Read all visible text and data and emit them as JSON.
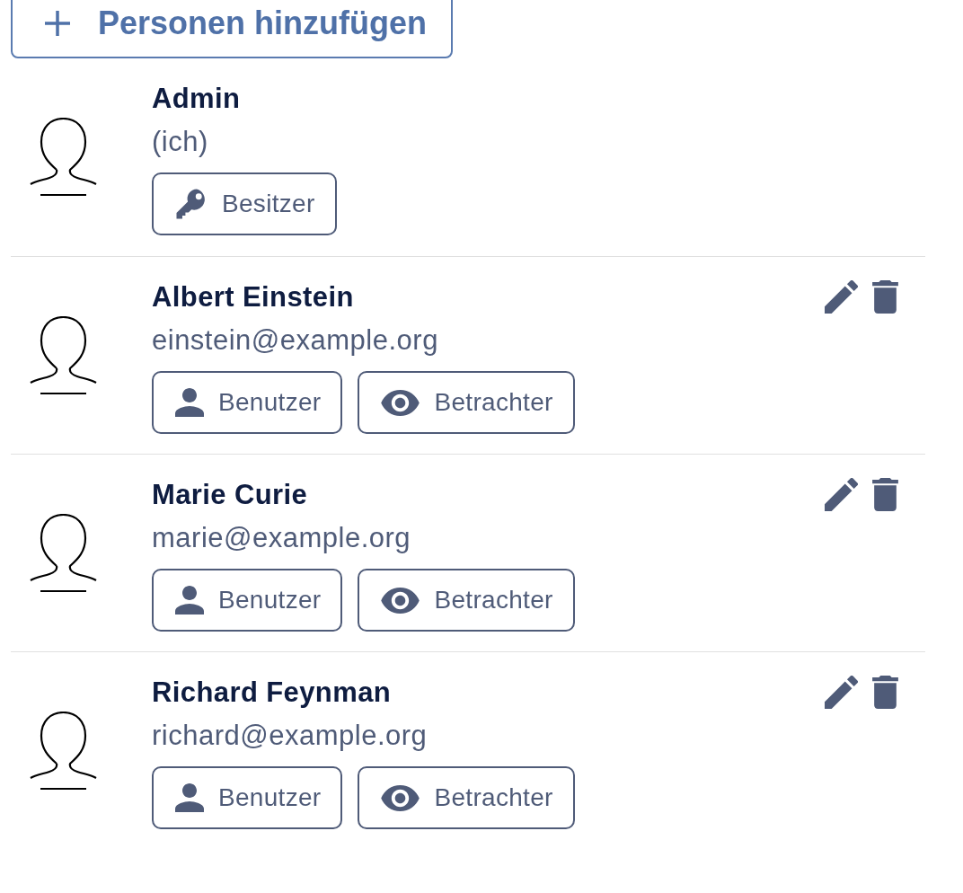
{
  "add_button": {
    "label": "Personen hinzufügen"
  },
  "people": [
    {
      "name": "Admin",
      "subtitle": "(ich)",
      "editable": false,
      "roles": [
        {
          "kind": "owner",
          "label": "Besitzer"
        }
      ]
    },
    {
      "name": "Albert Einstein",
      "subtitle": "einstein@example.org",
      "editable": true,
      "roles": [
        {
          "kind": "user",
          "label": "Benutzer"
        },
        {
          "kind": "viewer",
          "label": "Betrachter"
        }
      ]
    },
    {
      "name": "Marie Curie",
      "subtitle": "marie@example.org",
      "editable": true,
      "roles": [
        {
          "kind": "user",
          "label": "Benutzer"
        },
        {
          "kind": "viewer",
          "label": "Betrachter"
        }
      ]
    },
    {
      "name": "Richard Feynman",
      "subtitle": "richard@example.org",
      "editable": true,
      "roles": [
        {
          "kind": "user",
          "label": "Benutzer"
        },
        {
          "kind": "viewer",
          "label": "Betrachter"
        }
      ]
    }
  ]
}
